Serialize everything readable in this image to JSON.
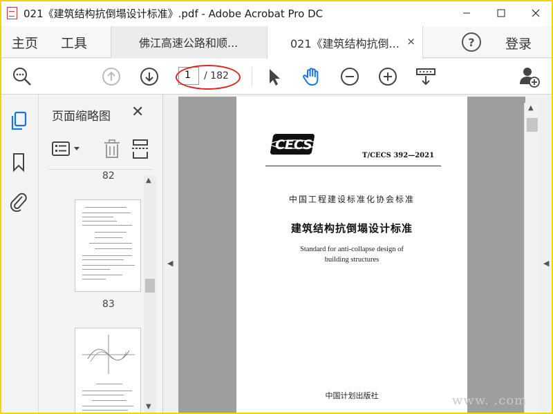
{
  "window": {
    "title": "021《建筑结构抗倒塌设计标准》.pdf - Adobe Acrobat Pro DC",
    "minimize_glyph": "—",
    "maximize_glyph": "☐",
    "close_glyph": "✕"
  },
  "tabs": {
    "home": "主页",
    "tools": "工具",
    "documents": [
      {
        "label": "佛江高速公路和顺...",
        "active": false
      },
      {
        "label": "021《建筑结构抗倒...",
        "active": true
      }
    ],
    "close_glyph": "×",
    "help_glyph": "?",
    "login": "登录"
  },
  "toolbar": {
    "current_page": "1",
    "total_pages": "/ 182",
    "icons": [
      "zoom-search-icon",
      "page-up-icon",
      "page-down-icon",
      "select-arrow-icon",
      "hand-icon",
      "zoom-out-icon",
      "zoom-in-icon",
      "fit-page-icon",
      "add-user-icon"
    ],
    "annotation_color": "#e0201a",
    "accent_color": "#1473e6"
  },
  "rail": {
    "icons": [
      "pages-icon",
      "bookmark-icon",
      "attachment-icon"
    ]
  },
  "thumbnails": {
    "title": "页面缩略图",
    "close_glyph": "✕",
    "pages": [
      {
        "label": "82"
      },
      {
        "label": "83"
      }
    ]
  },
  "document": {
    "logo_text": "CECS",
    "standard_code": "T/CECS 392—2021",
    "association": "中国工程建设标准化协会标准",
    "title_cn": "建筑结构抗倒塌设计标准",
    "title_en_line1": "Standard for anti-collapse design of",
    "title_en_line2": "building structures",
    "publisher": "中国计划出版社"
  },
  "watermark": "www.      .com"
}
